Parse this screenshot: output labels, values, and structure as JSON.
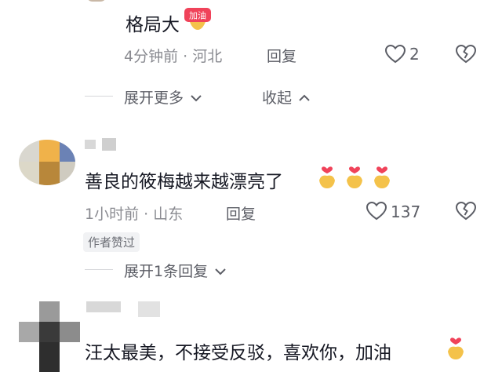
{
  "reply1": {
    "text": "格局大",
    "badge": "加油",
    "time": "4分钟前",
    "location": "河北",
    "reply_label": "回复",
    "likes": "2"
  },
  "thread1": {
    "expand_more": "展开更多",
    "collapse": "收起"
  },
  "comment2": {
    "text": "善良的筱梅越来越漂亮了",
    "time": "1小时前",
    "location": "山东",
    "reply_label": "回复",
    "likes": "137",
    "author_badge": "作者赞过",
    "expand_replies": "展开1条回复"
  },
  "comment3": {
    "text": "汪太最美，不接受反驳，喜欢你，加油"
  },
  "colors": {
    "text_primary": "#161823",
    "text_secondary": "#8a8b91",
    "divider": "#d6d7da",
    "heart_gold": "#f4c24a",
    "heart_red": "#f0435a"
  },
  "icons": [
    "heart-icon",
    "broken-heart-icon",
    "chevron-down-icon",
    "chevron-up-icon",
    "bixin-emoji-icon",
    "jiayou-badge-icon"
  ]
}
